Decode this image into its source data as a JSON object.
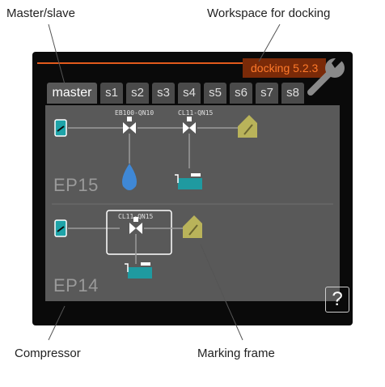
{
  "callouts": {
    "master_slave": "Master/slave",
    "workspace": "Workspace for docking",
    "compressor": "Compressor",
    "marking_frame": "Marking frame"
  },
  "header": {
    "menu_title": "docking 5.2.3"
  },
  "tabs": [
    "master",
    "s1",
    "s2",
    "s3",
    "s4",
    "s5",
    "s6",
    "s7",
    "s8"
  ],
  "active_tab": "master",
  "units": [
    {
      "label": "EP15",
      "components": [
        "EB100-QN10",
        "CL11-QN15"
      ]
    },
    {
      "label": "EP14",
      "components": [
        "CL11-QN15"
      ]
    }
  ],
  "help_label": "?",
  "colors": {
    "accent": "#e25a1c",
    "screen_bg": "#0a0a0a",
    "panel_bg": "#595959"
  },
  "icons": [
    "wrench-icon",
    "compressor-icon",
    "valve-icon",
    "water-drop-icon",
    "pool-icon",
    "house-icon",
    "help-icon"
  ]
}
